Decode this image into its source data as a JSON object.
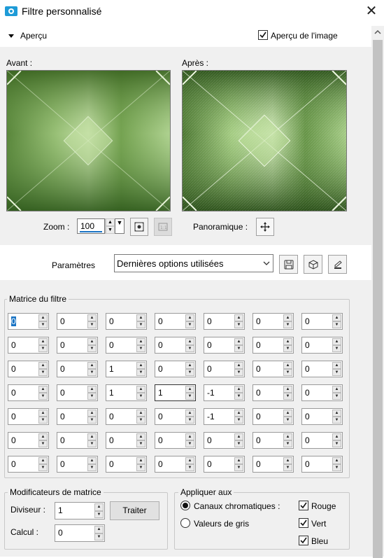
{
  "window": {
    "title": "Filtre personnalisé"
  },
  "apercu": {
    "section_label": "Aperçu",
    "checkbox_label": "Aperçu de l'image",
    "checked": true
  },
  "preview": {
    "before_label": "Avant :",
    "after_label": "Après :",
    "zoom_label": "Zoom :",
    "zoom_value": "100",
    "pan_label": "Panoramique :"
  },
  "params": {
    "label": "Paramètres",
    "selected": "Dernières options utilisées"
  },
  "matrix": {
    "title": "Matrice du filtre",
    "rows": [
      [
        "0",
        "0",
        "0",
        "0",
        "0",
        "0",
        "0"
      ],
      [
        "0",
        "0",
        "0",
        "0",
        "0",
        "0",
        "0"
      ],
      [
        "0",
        "0",
        "1",
        "0",
        "0",
        "0",
        "0"
      ],
      [
        "0",
        "0",
        "1",
        "1",
        "-1",
        "0",
        "0"
      ],
      [
        "0",
        "0",
        "0",
        "0",
        "-1",
        "0",
        "0"
      ],
      [
        "0",
        "0",
        "0",
        "0",
        "0",
        "0",
        "0"
      ],
      [
        "0",
        "0",
        "0",
        "0",
        "0",
        "0",
        "0"
      ]
    ]
  },
  "modifiers": {
    "title": "Modificateurs de matrice",
    "divisor_label": "Diviseur :",
    "divisor_value": "1",
    "calc_label": "Calcul :",
    "calc_value": "0",
    "apply_button": "Traiter"
  },
  "apply_to": {
    "title": "Appliquer aux",
    "radio_channels": "Canaux chromatiques :",
    "radio_grey": "Valeurs de gris",
    "selected_radio": "channels",
    "red": "Rouge",
    "green": "Vert",
    "blue": "Bleu",
    "red_checked": true,
    "green_checked": true,
    "blue_checked": true
  },
  "colors": {
    "accent": "#1a74c4",
    "panel": "#f0f0f0",
    "preview_green": "#5a8a3a"
  }
}
